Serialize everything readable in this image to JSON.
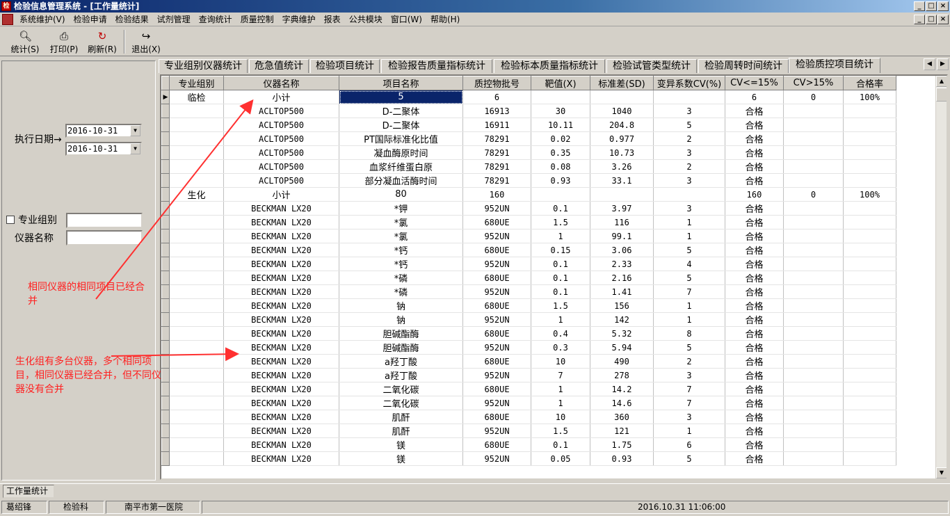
{
  "window": {
    "title": "检验信息管理系统 - [工作量统计]",
    "app_icon": "lab-app-icon",
    "buttons": [
      "minimize",
      "maximize",
      "close"
    ]
  },
  "menu": [
    "系统维护(V)",
    "检验申请",
    "检验结果",
    "试剂管理",
    "查询统计",
    "质量控制",
    "字典维护",
    "报表",
    "公共模块",
    "窗口(W)",
    "帮助(H)"
  ],
  "toolbar": [
    {
      "label": "统计(S)",
      "icon": "search-icon"
    },
    {
      "label": "打印(P)",
      "icon": "printer-icon"
    },
    {
      "label": "刷新(R)",
      "icon": "refresh-icon"
    },
    {
      "label": "退出(X)",
      "icon": "exit-door-icon"
    }
  ],
  "filters": {
    "date_label": "执行日期→",
    "date_from": "2016-10-31",
    "date_to": "2016-10-31",
    "group_label": "专业组别",
    "group_checked": false,
    "instrument_label": "仪器名称",
    "group_value": "",
    "instrument_value": ""
  },
  "tabs": [
    "专业组别仪器统计",
    "危急值统计",
    "检验项目统计",
    "检验报告质量指标统计",
    "检验标本质量指标统计",
    "检验试管类型统计",
    "检验周转时间统计",
    "检验质控项目统计"
  ],
  "active_tab": 7,
  "grid": {
    "columns": [
      "专业组别",
      "仪器名称",
      "项目名称",
      "质控物批号",
      "靶值(X)",
      "标准差(SD)",
      "变异系数CV(%)",
      "CV<=15%",
      "CV>15%",
      "合格率"
    ],
    "rows": [
      [
        "临检",
        "小计",
        "5",
        "6",
        "",
        "",
        "",
        "6",
        "0",
        "100%"
      ],
      [
        "",
        "ACLTOP500",
        "D-二聚体",
        "16913",
        "30",
        "1040",
        "3",
        "合格",
        "",
        ""
      ],
      [
        "",
        "ACLTOP500",
        "D-二聚体",
        "16911",
        "10.11",
        "204.8",
        "5",
        "合格",
        "",
        ""
      ],
      [
        "",
        "ACLTOP500",
        "PT国际标准化比值",
        "78291",
        "0.02",
        "0.977",
        "2",
        "合格",
        "",
        ""
      ],
      [
        "",
        "ACLTOP500",
        "凝血酶原时间",
        "78291",
        "0.35",
        "10.73",
        "3",
        "合格",
        "",
        ""
      ],
      [
        "",
        "ACLTOP500",
        "血浆纤维蛋白原",
        "78291",
        "0.08",
        "3.26",
        "2",
        "合格",
        "",
        ""
      ],
      [
        "",
        "ACLTOP500",
        "部分凝血活酶时间",
        "78291",
        "0.93",
        "33.1",
        "3",
        "合格",
        "",
        ""
      ],
      [
        "生化",
        "小计",
        "80",
        "160",
        "",
        "",
        "",
        "160",
        "0",
        "100%"
      ],
      [
        "",
        "BECKMAN LX20",
        "*钾",
        "952UN",
        "0.1",
        "3.97",
        "3",
        "合格",
        "",
        ""
      ],
      [
        "",
        "BECKMAN LX20",
        "*氯",
        "680UE",
        "1.5",
        "116",
        "1",
        "合格",
        "",
        ""
      ],
      [
        "",
        "BECKMAN LX20",
        "*氯",
        "952UN",
        "1",
        "99.1",
        "1",
        "合格",
        "",
        ""
      ],
      [
        "",
        "BECKMAN LX20",
        "*钙",
        "680UE",
        "0.15",
        "3.06",
        "5",
        "合格",
        "",
        ""
      ],
      [
        "",
        "BECKMAN LX20",
        "*钙",
        "952UN",
        "0.1",
        "2.33",
        "4",
        "合格",
        "",
        ""
      ],
      [
        "",
        "BECKMAN LX20",
        "*磷",
        "680UE",
        "0.1",
        "2.16",
        "5",
        "合格",
        "",
        ""
      ],
      [
        "",
        "BECKMAN LX20",
        "*磷",
        "952UN",
        "0.1",
        "1.41",
        "7",
        "合格",
        "",
        ""
      ],
      [
        "",
        "BECKMAN LX20",
        "钠",
        "680UE",
        "1.5",
        "156",
        "1",
        "合格",
        "",
        ""
      ],
      [
        "",
        "BECKMAN LX20",
        "钠",
        "952UN",
        "1",
        "142",
        "1",
        "合格",
        "",
        ""
      ],
      [
        "",
        "BECKMAN LX20",
        "胆碱酯酶",
        "680UE",
        "0.4",
        "5.32",
        "8",
        "合格",
        "",
        ""
      ],
      [
        "",
        "BECKMAN LX20",
        "胆碱酯酶",
        "952UN",
        "0.3",
        "5.94",
        "5",
        "合格",
        "",
        ""
      ],
      [
        "",
        "BECKMAN LX20",
        "a羟丁酸",
        "680UE",
        "10",
        "490",
        "2",
        "合格",
        "",
        ""
      ],
      [
        "",
        "BECKMAN LX20",
        "a羟丁酸",
        "952UN",
        "7",
        "278",
        "3",
        "合格",
        "",
        ""
      ],
      [
        "",
        "BECKMAN LX20",
        "二氧化碳",
        "680UE",
        "1",
        "14.2",
        "7",
        "合格",
        "",
        ""
      ],
      [
        "",
        "BECKMAN LX20",
        "二氧化碳",
        "952UN",
        "1",
        "14.6",
        "7",
        "合格",
        "",
        ""
      ],
      [
        "",
        "BECKMAN LX20",
        "肌酐",
        "680UE",
        "10",
        "360",
        "3",
        "合格",
        "",
        ""
      ],
      [
        "",
        "BECKMAN LX20",
        "肌酐",
        "952UN",
        "1.5",
        "121",
        "1",
        "合格",
        "",
        ""
      ],
      [
        "",
        "BECKMAN LX20",
        "镁",
        "680UE",
        "0.1",
        "1.75",
        "6",
        "合格",
        "",
        ""
      ],
      [
        "",
        "BECKMAN LX20",
        "镁",
        "952UN",
        "0.05",
        "0.93",
        "5",
        "合格",
        "",
        ""
      ]
    ],
    "current_row": 0,
    "selected_cell": [
      0,
      2
    ]
  },
  "annotations": {
    "note1": "相同仪器的相同项目已经合并",
    "note2": "生化组有多台仪器，多个相同项目，相同仪器已经合并，但不同仪器没有合并",
    "color": "#ff2020"
  },
  "bottom_tab": "工作量统计",
  "status": {
    "user": "葛绍锋",
    "dept": "检验科",
    "hospital": "南平市第一医院",
    "datetime": "2016.10.31 11:06:00"
  }
}
